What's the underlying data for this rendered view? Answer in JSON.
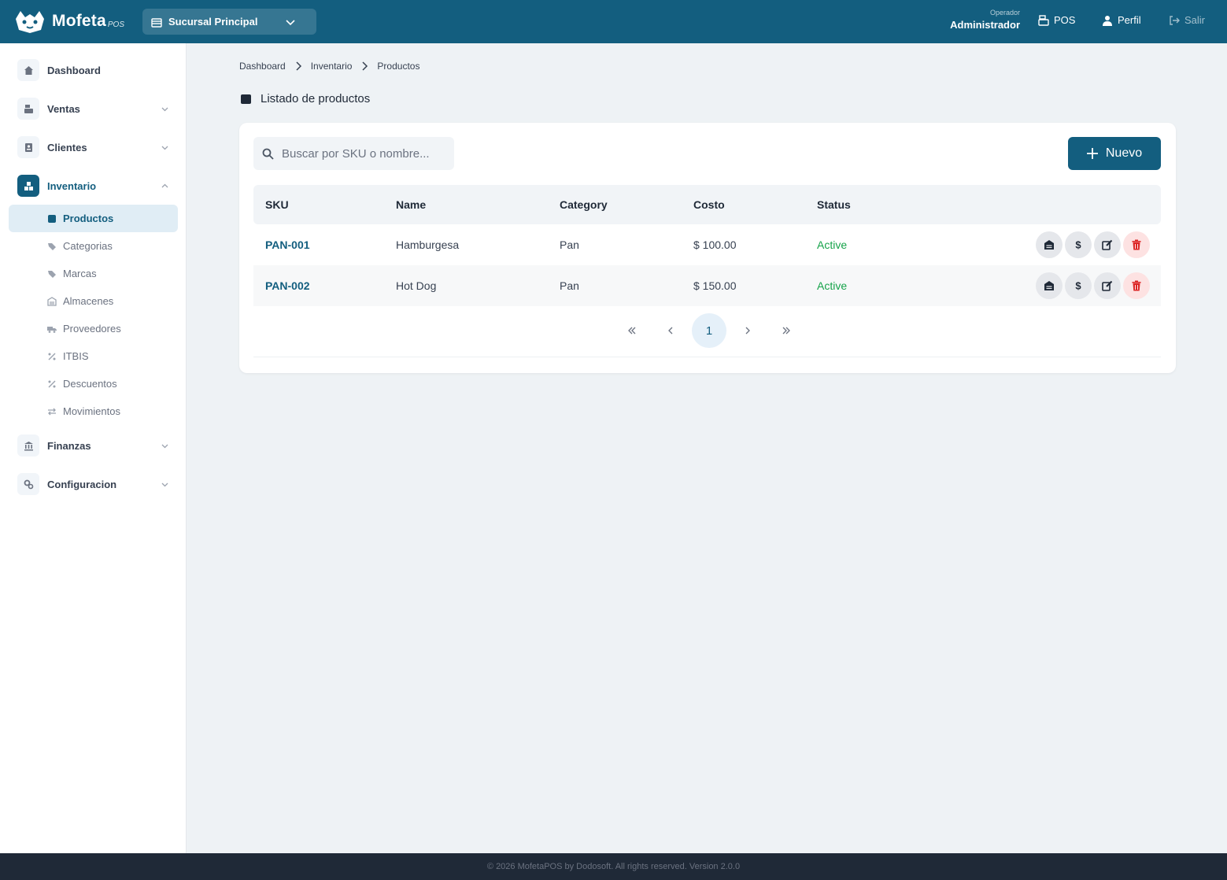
{
  "app": {
    "name": "Mofeta",
    "name_suffix": "POS",
    "brand_color": "#135e7f"
  },
  "header": {
    "branch": "Sucursal Principal",
    "operator_label": "Operador",
    "operator_name": "Administrador",
    "links": {
      "pos": "POS",
      "perfil": "Perfil",
      "salir": "Salir"
    }
  },
  "sidebar": {
    "items": [
      {
        "label": "Dashboard",
        "icon": "home-icon"
      },
      {
        "label": "Ventas",
        "icon": "register-icon"
      },
      {
        "label": "Clientes",
        "icon": "contact-icon"
      },
      {
        "label": "Inventario",
        "icon": "boxes-icon"
      },
      {
        "label": "Finanzas",
        "icon": "bank-icon"
      },
      {
        "label": "Configuracion",
        "icon": "gears-icon"
      }
    ],
    "inventario_sub": [
      {
        "label": "Productos",
        "icon": "box-icon"
      },
      {
        "label": "Categorias",
        "icon": "tags-icon"
      },
      {
        "label": "Marcas",
        "icon": "tags-icon"
      },
      {
        "label": "Almacenes",
        "icon": "warehouse-icon"
      },
      {
        "label": "Proveedores",
        "icon": "truck-icon"
      },
      {
        "label": "ITBIS",
        "icon": "percent-icon"
      },
      {
        "label": "Descuentos",
        "icon": "percent-icon"
      },
      {
        "label": "Movimientos",
        "icon": "exchange-icon"
      }
    ]
  },
  "breadcrumb": [
    "Dashboard",
    "Inventario",
    "Productos"
  ],
  "page": {
    "title": "Listado de productos"
  },
  "search": {
    "placeholder": "Buscar por SKU o nombre..."
  },
  "buttons": {
    "new": "Nuevo"
  },
  "table": {
    "headers": [
      "SKU",
      "Name",
      "Category",
      "Costo",
      "Status"
    ],
    "rows": [
      {
        "sku": "PAN-001",
        "name": "Hamburgesa",
        "category": "Pan",
        "cost": "$ 100.00",
        "status": "Active"
      },
      {
        "sku": "PAN-002",
        "name": "Hot Dog",
        "category": "Pan",
        "cost": "$ 150.00",
        "status": "Active"
      }
    ]
  },
  "pagination": {
    "current": "1"
  },
  "footer": {
    "text": "© 2026 MofetaPOS by Dodosoft. All rights reserved. Version 2.0.0"
  }
}
